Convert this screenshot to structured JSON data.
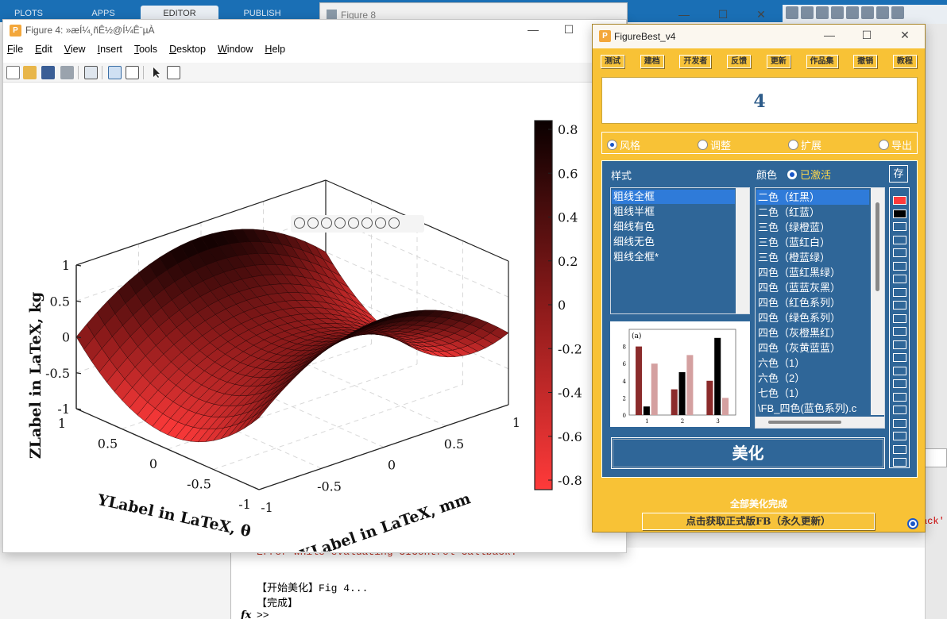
{
  "background": {
    "tabs": [
      "PLOTS",
      "APPS",
      "EDITOR",
      "PUBLISH"
    ],
    "right_link": "ack'",
    "cmd": {
      "error": "Error while evaluating UIControl Callback.",
      "line1": "【开始美化】Fig 4...",
      "line2": "【完成】",
      "prompt_fx": "fx",
      "prompt": ">>"
    }
  },
  "figure8": {
    "title": "Figure 8"
  },
  "figure4": {
    "title": "Figure 4: »æÍ¼¸ñÊ½@Í¼Ê¨µÀ",
    "menu": [
      "File",
      "Edit",
      "View",
      "Insert",
      "Tools",
      "Desktop",
      "Window",
      "Help"
    ],
    "plot": {
      "xlabel": "XLabel in LaTeX, mm",
      "ylabel": "YLabel in LaTeX, θ",
      "zlabel": "ZLabel in LaTeX, kg",
      "z_ticks": [
        "1",
        "0.5",
        "0",
        "-0.5",
        "-1"
      ],
      "x_ticks": [
        "-1",
        "-0.5",
        "0",
        "0.5",
        "1"
      ],
      "y_ticks": [
        "-1",
        "-0.5",
        "0",
        "0.5",
        "1"
      ],
      "colorbar_ticks": [
        "0.8",
        "0.6",
        "0.4",
        "0.2",
        "0",
        "-0.2",
        "-0.4",
        "-0.6",
        "-0.8"
      ],
      "surface": "saddle z = x^2 - y^2 style (corners ±0.8)",
      "colormap": [
        "#ff3a3a",
        "#8b1a1a",
        "#000000"
      ]
    }
  },
  "figurebest": {
    "title": "FigureBest_v4",
    "buttons": [
      "测试",
      "建档",
      "开发者",
      "反馈",
      "更新",
      "作品集",
      "撤销",
      "教程"
    ],
    "display_value": "4",
    "tabs": [
      {
        "label": "风格",
        "selected": true
      },
      {
        "label": "调整",
        "selected": false
      },
      {
        "label": "扩展",
        "selected": false
      },
      {
        "label": "导出",
        "selected": false
      }
    ],
    "style_label": "样式",
    "color_label": "颜色",
    "active_label": "已激活",
    "save_label": "存",
    "styles": [
      "粗线全框",
      "粗线半框",
      "细线有色",
      "细线无色",
      "粗线全框*"
    ],
    "colors": [
      "二色（红黑）",
      "二色（红蓝）",
      "三色（绿橙蓝）",
      "三色（蓝红白）",
      "三色（橙蓝绿）",
      "四色（蓝红黑绿）",
      "四色（蓝蓝灰黑）",
      "四色（红色系列）",
      "四色（绿色系列）",
      "四色（灰橙黑红）",
      "四色（灰黄蓝蓝）",
      "六色（1）",
      "六色（2）",
      "七色（1）",
      "\\FB_四色(蓝色系列).c"
    ],
    "swatch_colors": [
      "#ff3b3b",
      "#000000"
    ],
    "preview": {
      "tag": "(a)",
      "y_ticks": [
        "8",
        "6",
        "4",
        "2",
        "0"
      ],
      "x_ticks": [
        "1",
        "2",
        "3"
      ],
      "groups": [
        {
          "values": [
            8,
            1,
            6
          ]
        },
        {
          "values": [
            3,
            5,
            7
          ]
        },
        {
          "values": [
            4,
            9,
            2
          ]
        }
      ],
      "colors": [
        "#8b2b2b",
        "#000000",
        "#d4a0a0"
      ]
    },
    "beautify_label": "美化",
    "status": "全部美化完成",
    "get_label": "点击获取正式版FB（永久更新）"
  }
}
